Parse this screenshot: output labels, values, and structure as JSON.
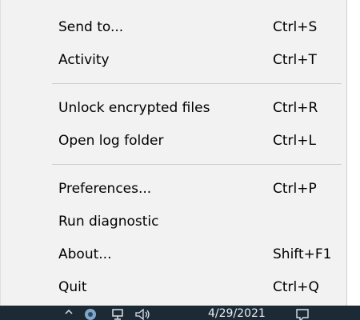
{
  "context_menu": {
    "items": [
      {
        "label": "Send to...",
        "shortcut": "Ctrl+S"
      },
      {
        "label": "Activity",
        "shortcut": "Ctrl+T"
      },
      {
        "label": "Unlock encrypted files",
        "shortcut": "Ctrl+R"
      },
      {
        "label": "Open log folder",
        "shortcut": "Ctrl+L"
      },
      {
        "label": "Preferences...",
        "shortcut": "Ctrl+P"
      },
      {
        "label": "Run diagnostic",
        "shortcut": ""
      },
      {
        "label": "About...",
        "shortcut": "Shift+F1"
      },
      {
        "label": "Quit",
        "shortcut": "Ctrl+Q"
      }
    ]
  },
  "taskbar": {
    "date": "4/29/2021",
    "icons": [
      "chevron-up-icon",
      "app-tray-icon",
      "network-icon",
      "speaker-icon",
      "notification-icon"
    ]
  },
  "colors": {
    "menu_bg": "#f2f2f2",
    "separator": "#cfcfcf",
    "taskbar_bg": "#1c2a36"
  }
}
